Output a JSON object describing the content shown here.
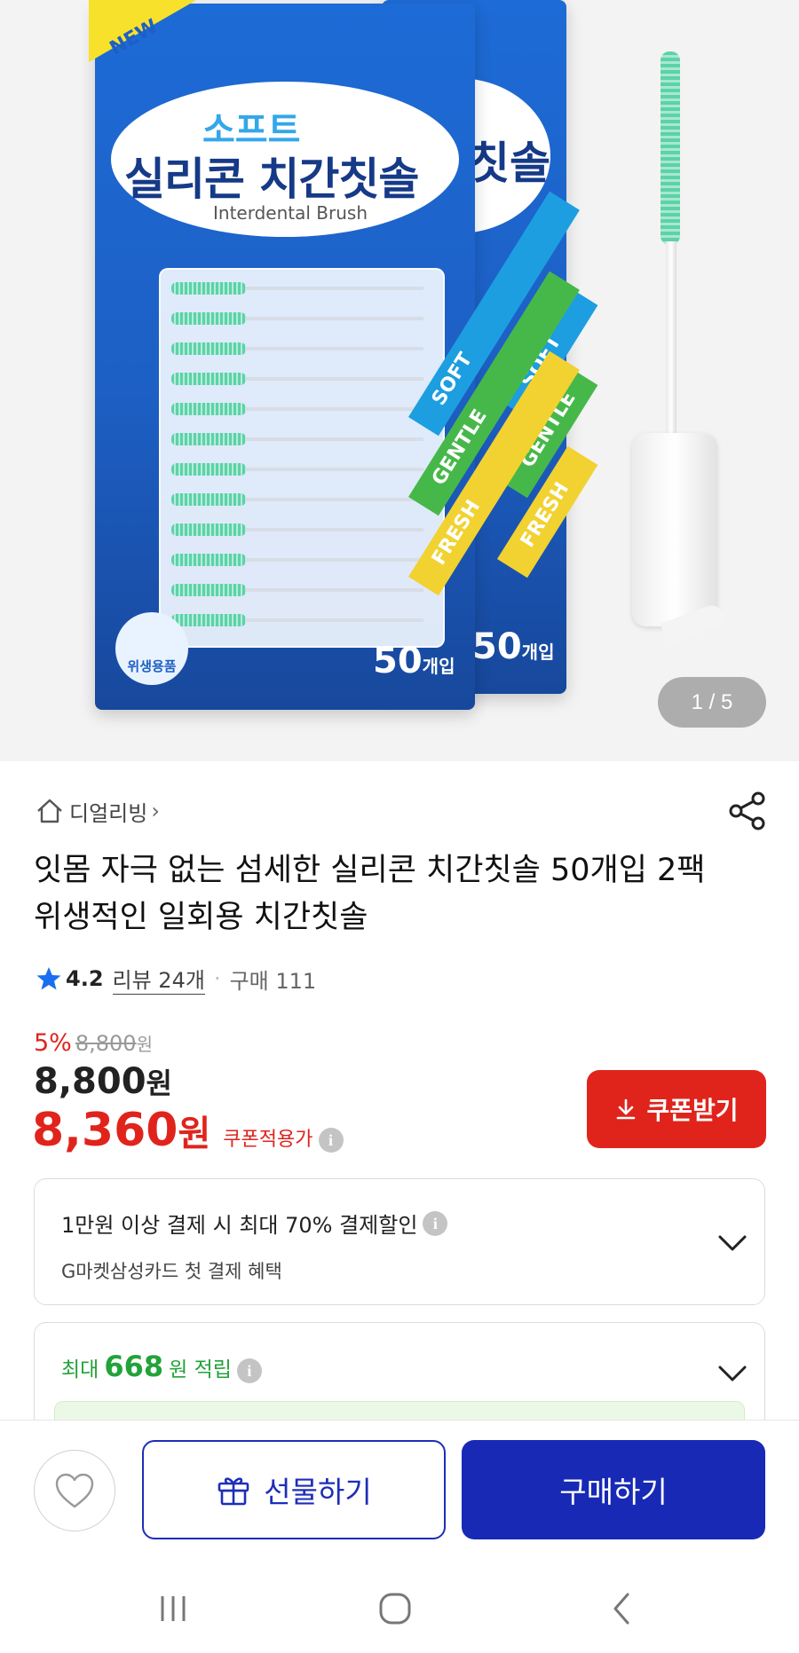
{
  "gallery": {
    "page_indicator": "1 / 5",
    "package_texts": {
      "badge": "NEW",
      "soft": "소프트",
      "product_name": "실리콘 치간칫솔",
      "product_name_back": "칫솔",
      "subtitle": "Interdental Brush",
      "stripes": [
        "SOFT",
        "GENTLE",
        "FRESH"
      ],
      "hygiene": "위생용품",
      "count": "50",
      "count_unit": "개입",
      "count_back": "50",
      "count_unit_back": "개입"
    }
  },
  "store": {
    "name": "디얼리빙",
    "chevron": "›"
  },
  "product": {
    "title": "잇몸 자극 없는 섬세한 실리콘 치간칫솔 50개입 2팩 위생적인 일회용 치간칫솔",
    "rating": "4.2",
    "review_label": "리뷰 24개",
    "separator": "·",
    "purchase_label": "구매 111"
  },
  "price": {
    "discount": "5%",
    "original": "8,800",
    "original_unit": "원",
    "sale": "8,800",
    "sale_unit": "원",
    "coupon_price": "8,360",
    "coupon_unit": "원",
    "coupon_applicable": "쿠폰적용가"
  },
  "coupon_button": {
    "label": "쿠폰받기"
  },
  "payment_card": {
    "line1": "1만원 이상 결제 시 최대 70% 결제할인",
    "line2": "G마켓삼성카드 첫 결제 혜택"
  },
  "points_card": {
    "prefix": "최대",
    "amount": "668",
    "suffix": "원 적립"
  },
  "actions": {
    "gift": "선물하기",
    "buy": "구매하기"
  },
  "colors": {
    "accent_red": "#e0241c",
    "primary_blue": "#1729b5",
    "points_green": "#22a33a",
    "star_blue": "#1a6ef0"
  },
  "icons": {
    "home": "home-icon",
    "share": "share-icon",
    "star": "star-icon",
    "info": "info-icon",
    "download": "download-icon",
    "chevron_down": "chevron-down-icon",
    "heart": "heart-icon",
    "gift": "gift-icon",
    "recent_apps": "recent-apps-icon",
    "nav_home": "nav-home-icon",
    "nav_back": "nav-back-icon"
  }
}
